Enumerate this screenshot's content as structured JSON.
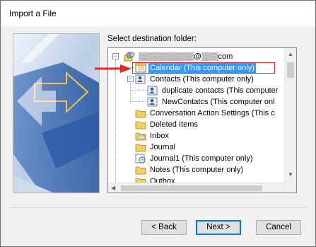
{
  "window": {
    "title": "Import a File"
  },
  "panel": {
    "label": "Select destination folder:"
  },
  "tree": {
    "root": {
      "label": "▒▒▒▒▒▒▒▒▒▒@▒▒▒com"
    },
    "items": [
      {
        "label": "Calendar (This computer only)",
        "icon": "calendar-icon",
        "selected": true
      },
      {
        "label": "Contacts (This computer only)",
        "icon": "contacts-icon"
      },
      {
        "label": "duplicate contacts (This computer",
        "icon": "contacts-icon"
      },
      {
        "label": "NewContatcs (This computer onl",
        "icon": "contacts-icon"
      },
      {
        "label": "Conversation Action Settings (This c",
        "icon": "folder-icon"
      },
      {
        "label": "Deleted Items",
        "icon": "folder-icon"
      },
      {
        "label": "Inbox",
        "icon": "inbox-icon"
      },
      {
        "label": "Journal",
        "icon": "folder-icon"
      },
      {
        "label": "Journal1 (This computer only)",
        "icon": "journal-icon"
      },
      {
        "label": "Notes (This computer only)",
        "icon": "folder-icon"
      },
      {
        "label": "Outbox",
        "icon": "outbox-icon"
      }
    ]
  },
  "buttons": {
    "back": "< Back",
    "next": "Next >",
    "cancel": "Cancel"
  },
  "colors": {
    "selection": "#3399ff",
    "highlight": "#e02828",
    "accent": "#0078d7"
  }
}
